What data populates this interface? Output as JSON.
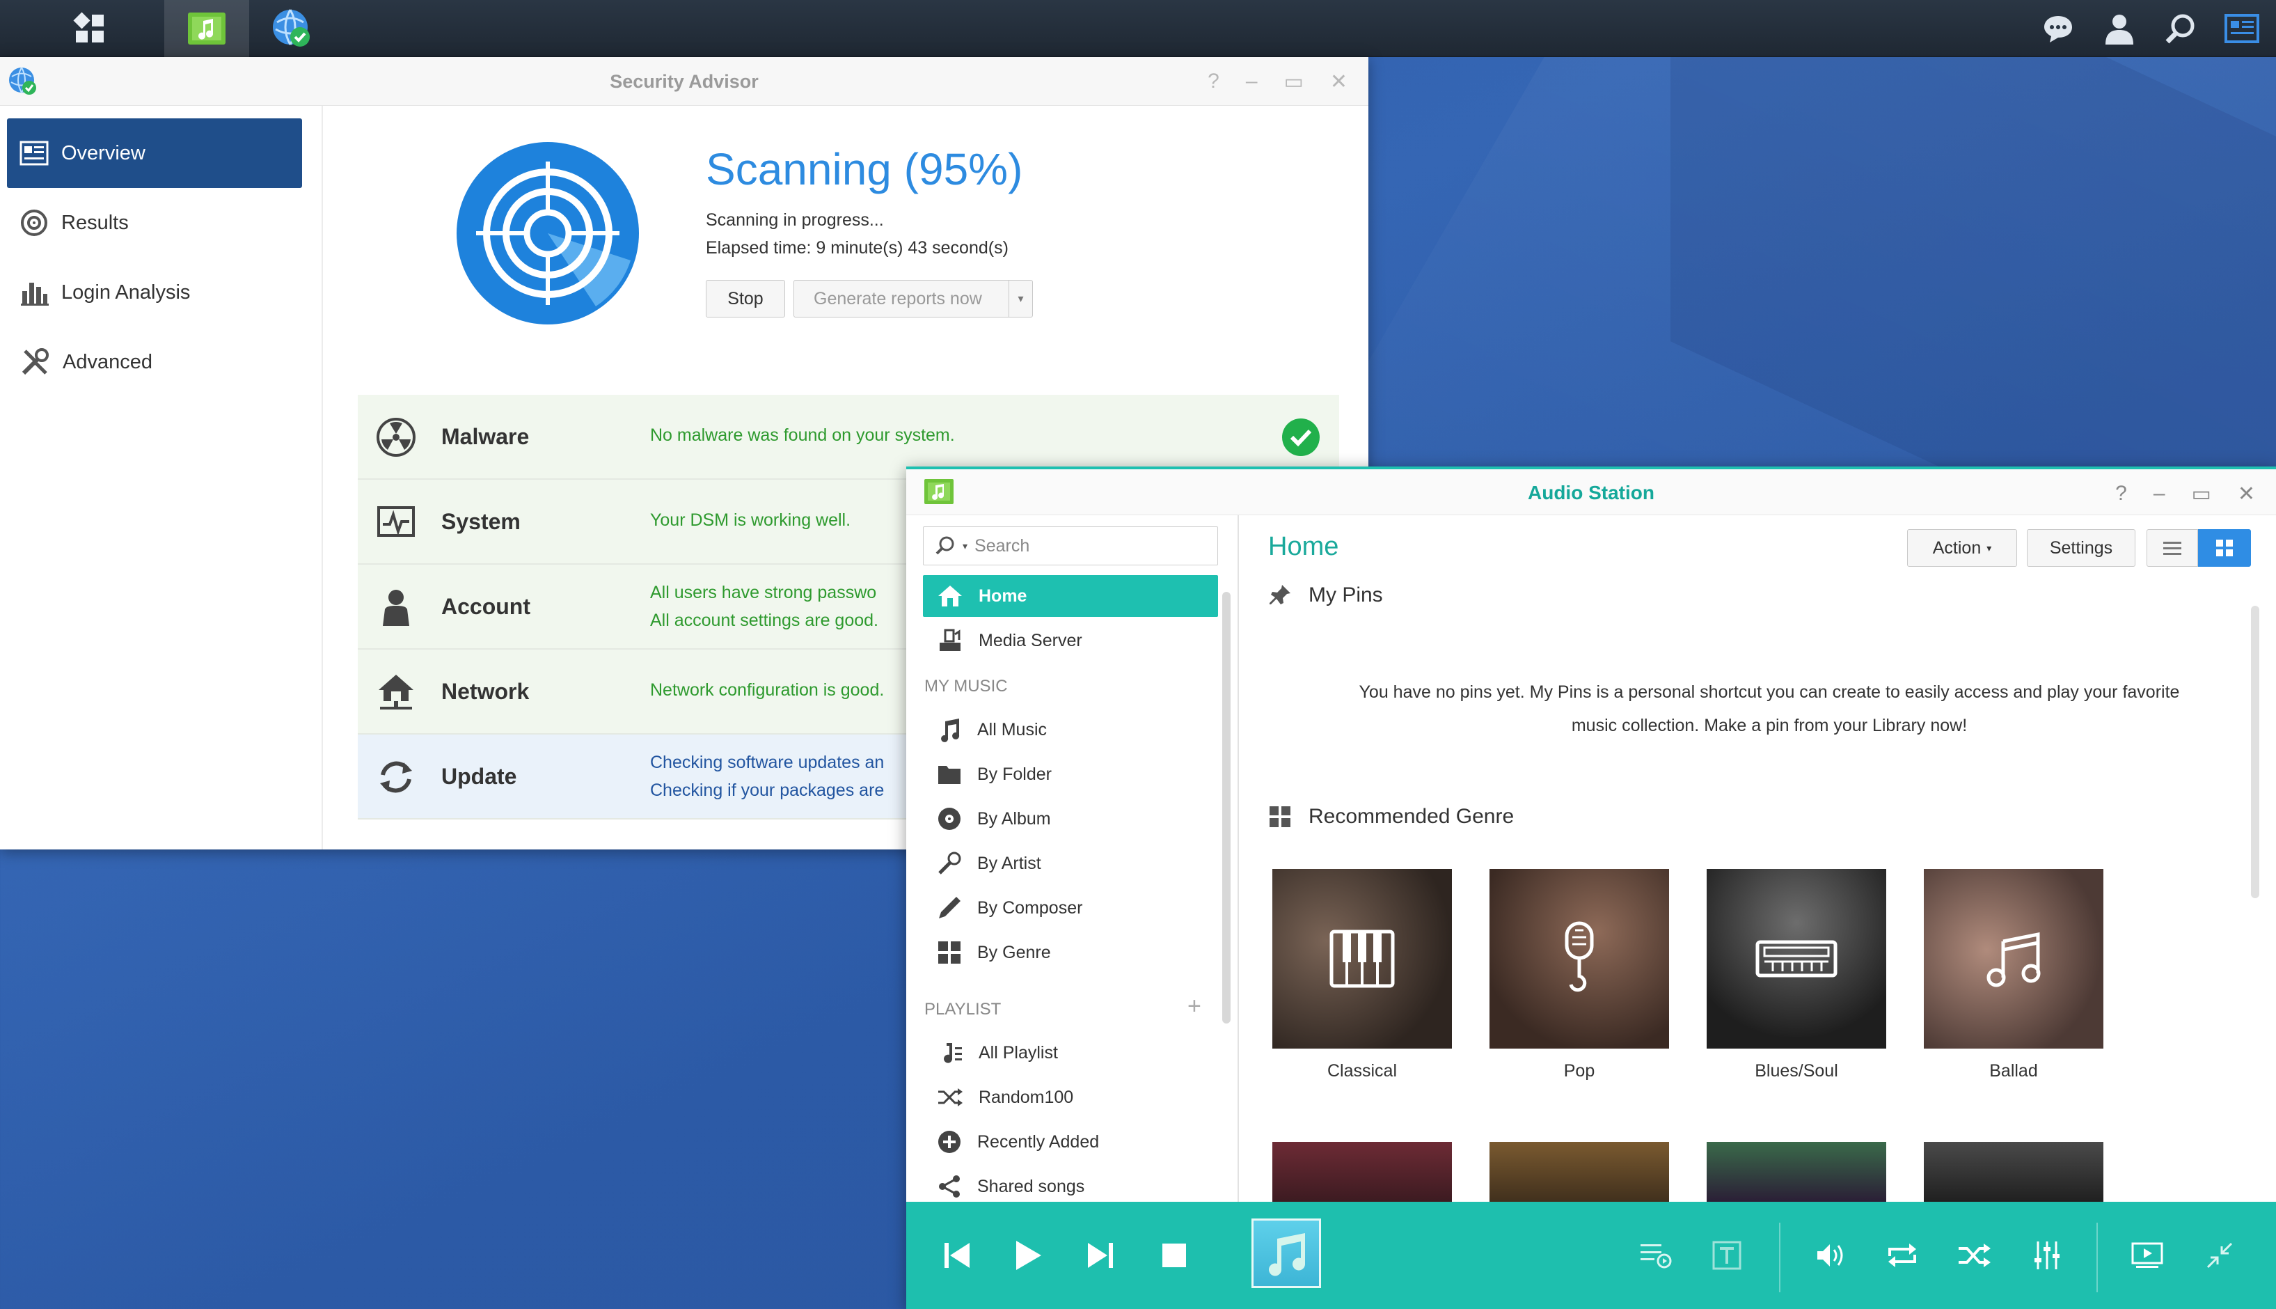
{
  "taskbar": {
    "apps": [
      "main-menu",
      "audio-station",
      "security-advisor"
    ],
    "right_icons": [
      "chat-icon",
      "user-icon",
      "search-icon",
      "widgets-icon"
    ]
  },
  "security_advisor": {
    "title": "Security Advisor",
    "nav": [
      {
        "label": "Overview",
        "icon": "overview-icon",
        "active": true
      },
      {
        "label": "Results",
        "icon": "results-icon"
      },
      {
        "label": "Login Analysis",
        "icon": "chart-icon"
      },
      {
        "label": "Advanced",
        "icon": "tools-icon"
      }
    ],
    "scan": {
      "title": "Scanning (95%)",
      "progress_percent": 95,
      "status": "Scanning in progress...",
      "elapsed": "Elapsed time: 9 minute(s) 43 second(s)",
      "stop_label": "Stop",
      "generate_label": "Generate reports now"
    },
    "rows": [
      {
        "name": "Malware",
        "msg1": "No malware was found on your system.",
        "msg2": "",
        "status": "ok"
      },
      {
        "name": "System",
        "msg1": "Your DSM is working well.",
        "msg2": ""
      },
      {
        "name": "Account",
        "msg1": "All users have strong passwo",
        "msg2": "All account settings are good."
      },
      {
        "name": "Network",
        "msg1": "Network configuration is good.",
        "msg2": ""
      },
      {
        "name": "Update",
        "msg1": "Checking software updates an",
        "msg2": "Checking if your packages are"
      }
    ]
  },
  "audio_station": {
    "title": "Audio Station",
    "search_placeholder": "Search",
    "nav": {
      "home": "Home",
      "media_server": "Media Server",
      "my_music_header": "MY MUSIC",
      "my_music": [
        "All Music",
        "By Folder",
        "By Album",
        "By Artist",
        "By Composer",
        "By Genre"
      ],
      "playlist_header": "PLAYLIST",
      "playlists": [
        "All Playlist",
        "Random100",
        "Recently Added",
        "Shared songs"
      ]
    },
    "main": {
      "heading": "Home",
      "action_label": "Action",
      "settings_label": "Settings",
      "pins_title": "My Pins",
      "pins_msg_line1": "You have no pins yet. My Pins is a personal shortcut you can create to easily access and play your favorite",
      "pins_msg_line2": "music collection. Make a pin from your Library now!",
      "genre_title": "Recommended Genre",
      "genres": [
        "Classical",
        "Pop",
        "Blues/Soul",
        "Ballad"
      ]
    },
    "colors": {
      "accent": "#1ebfae"
    }
  }
}
